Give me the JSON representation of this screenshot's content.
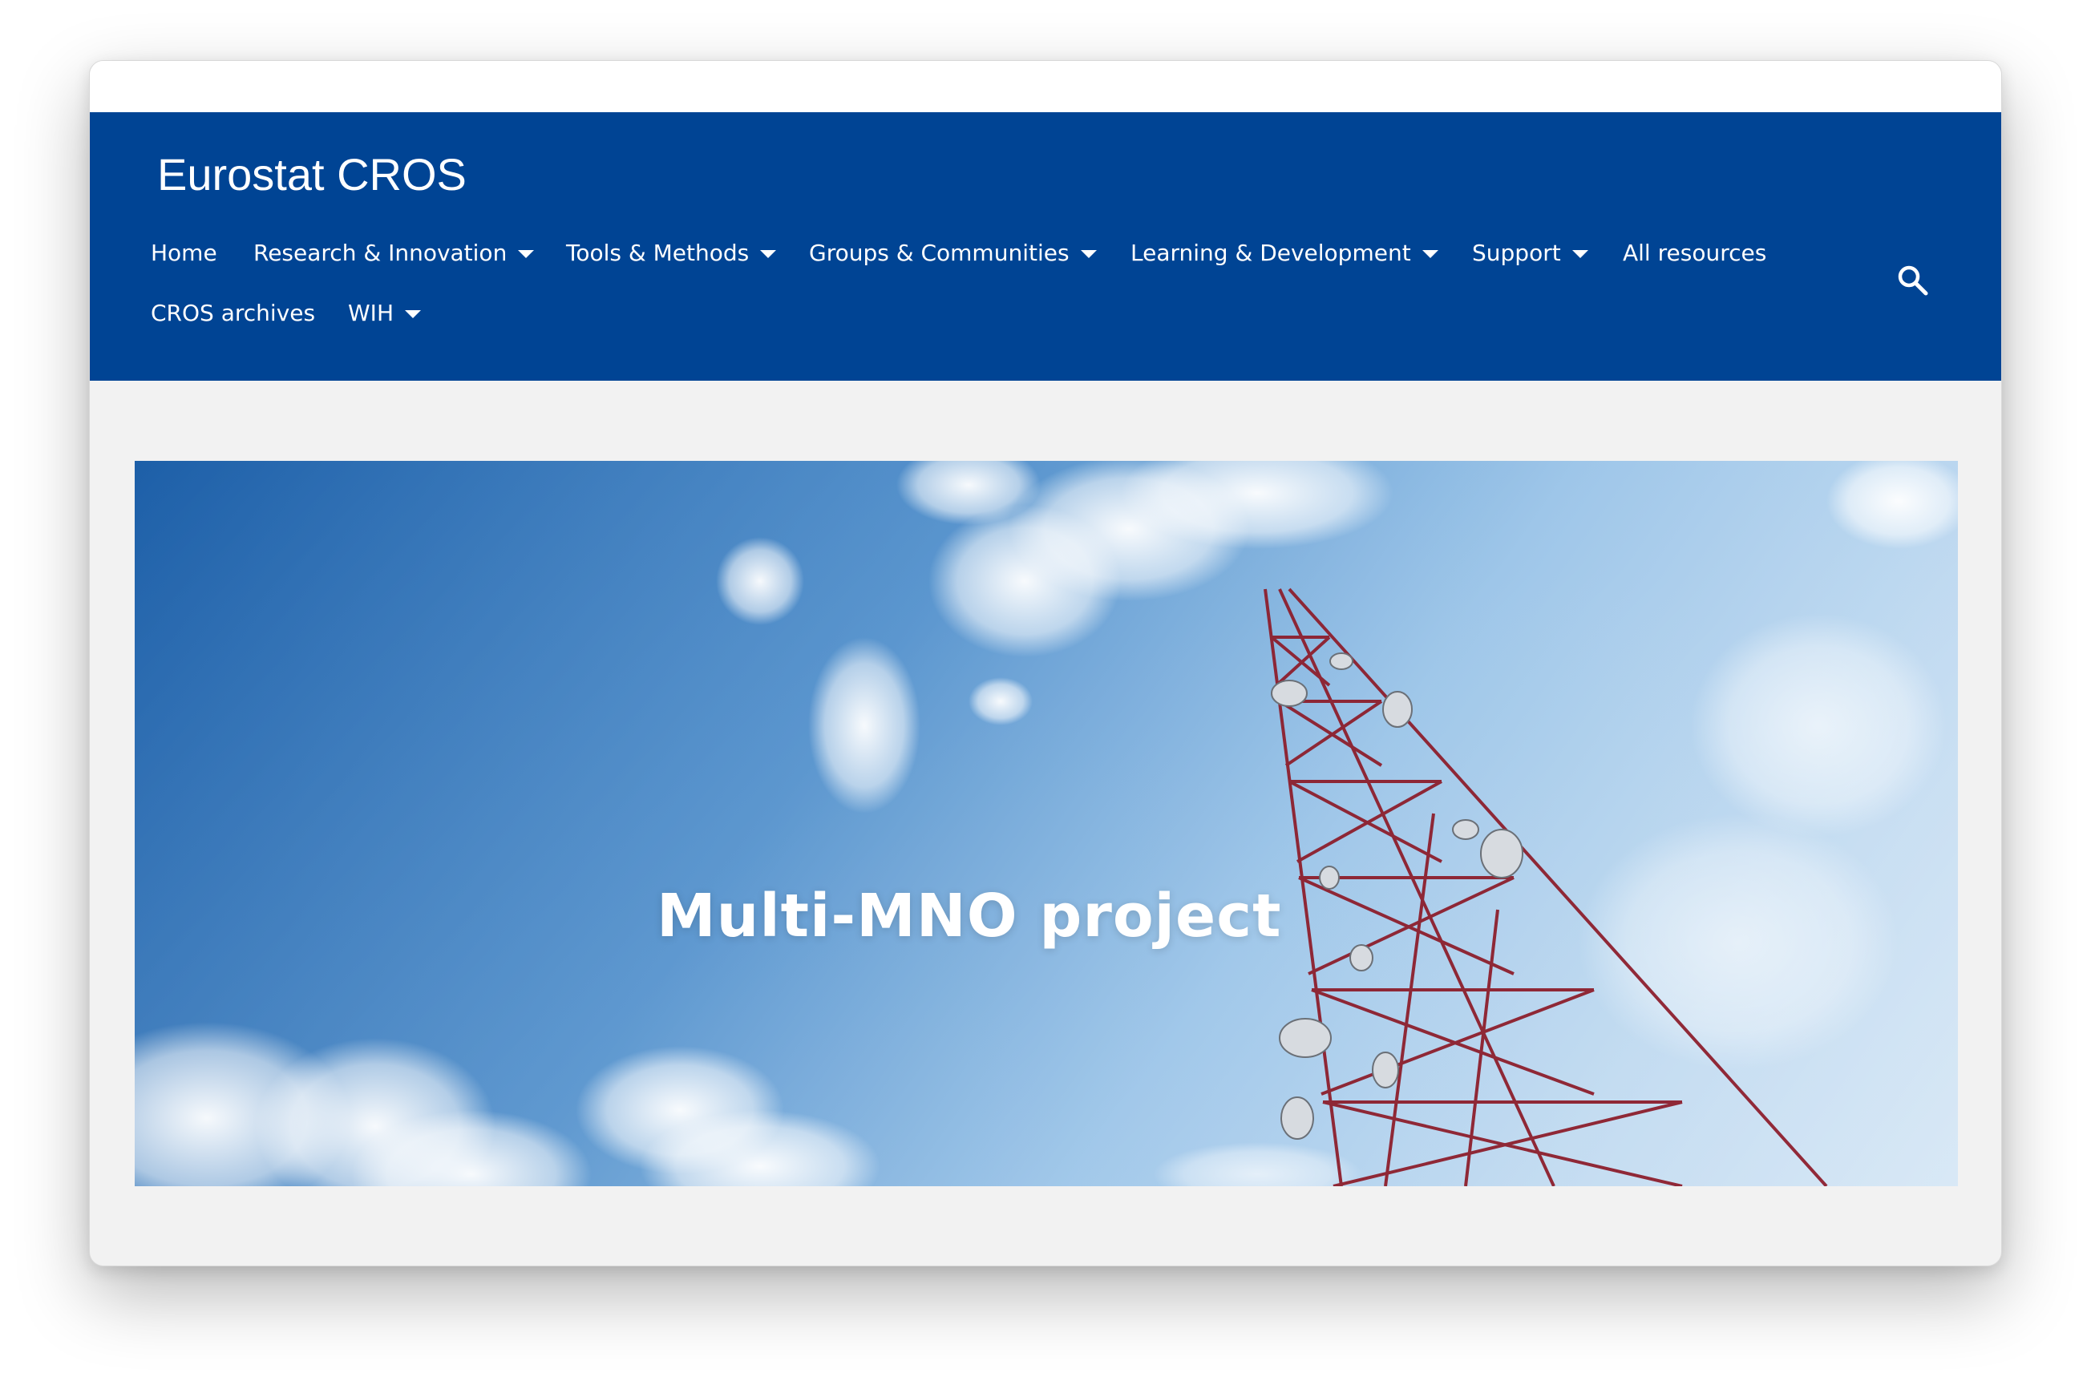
{
  "site": {
    "title": "Eurostat CROS",
    "brand_color": "#004494"
  },
  "nav": {
    "items": [
      {
        "label": "Home",
        "has_dropdown": false
      },
      {
        "label": "Research & Innovation",
        "has_dropdown": true
      },
      {
        "label": "Tools & Methods",
        "has_dropdown": true
      },
      {
        "label": "Groups & Communities",
        "has_dropdown": true
      },
      {
        "label": "Learning & Development",
        "has_dropdown": true
      },
      {
        "label": "Support",
        "has_dropdown": true
      },
      {
        "label": "All resources",
        "has_dropdown": false
      },
      {
        "label": "CROS archives",
        "has_dropdown": false
      },
      {
        "label": "WIH",
        "has_dropdown": true
      }
    ],
    "search_icon": "search-icon"
  },
  "hero": {
    "title": "Multi-MNO project",
    "image": "telecom-tower-blue-sky"
  }
}
